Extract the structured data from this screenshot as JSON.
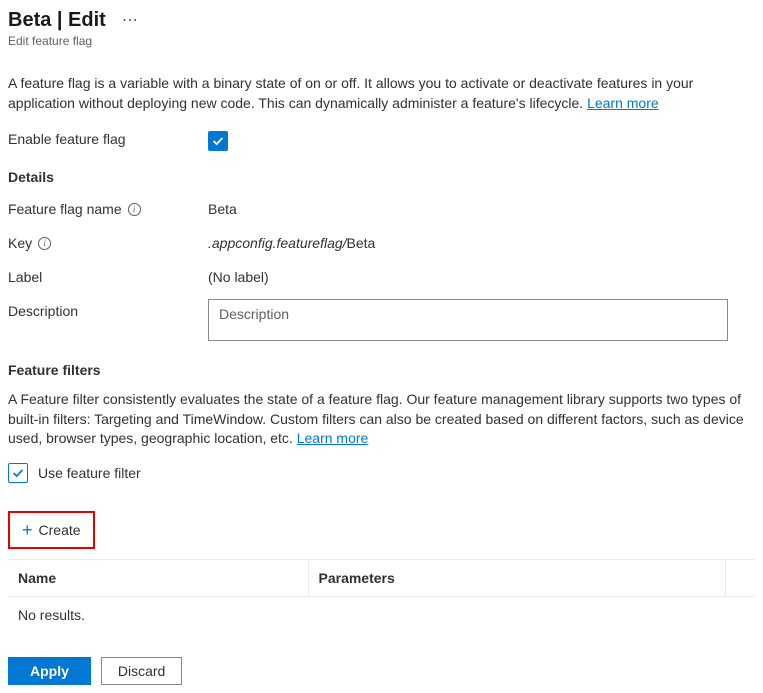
{
  "header": {
    "title": "Beta | Edit",
    "subtitle": "Edit feature flag"
  },
  "intro": {
    "text": "A feature flag is a variable with a binary state of on or off. It allows you to activate or deactivate features in your application without deploying new code. This can dynamically administer a feature's lifecycle. ",
    "learn_more": "Learn more"
  },
  "enable": {
    "label": "Enable feature flag",
    "checked": true
  },
  "details": {
    "heading": "Details",
    "name_label": "Feature flag name",
    "name_value": "Beta",
    "key_label": "Key",
    "key_prefix": ".appconfig.featureflag/",
    "key_value": "Beta",
    "label_label": "Label",
    "label_value": "(No label)",
    "description_label": "Description",
    "description_placeholder": "Description",
    "description_value": ""
  },
  "filters": {
    "heading": "Feature filters",
    "text": "A Feature filter consistently evaluates the state of a feature flag. Our feature management library supports two types of built-in filters: Targeting and TimeWindow. Custom filters can also be created based on different factors, such as device used, browser types, geographic location, etc. ",
    "learn_more": "Learn more",
    "use_label": "Use feature filter",
    "use_checked": true,
    "create_label": "Create",
    "table": {
      "col_name": "Name",
      "col_params": "Parameters",
      "empty": "No results."
    }
  },
  "actions": {
    "apply": "Apply",
    "discard": "Discard"
  }
}
